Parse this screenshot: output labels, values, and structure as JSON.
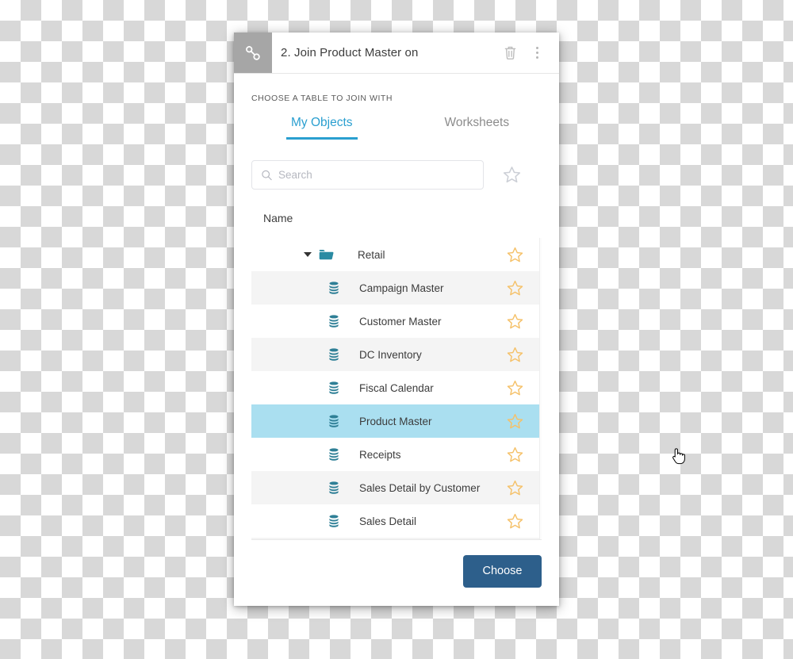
{
  "dialog": {
    "title": "2. Join Product Master on",
    "badge_icon": "link-icon",
    "delete_label": "Delete",
    "more_label": "More options"
  },
  "section": {
    "label": "CHOOSE A TABLE TO JOIN WITH"
  },
  "tabs": [
    {
      "label": "My Objects",
      "active": true
    },
    {
      "label": "Worksheets",
      "active": false
    }
  ],
  "search": {
    "placeholder": "Search",
    "value": "",
    "icon": "search-icon",
    "favorite_filter_icon": "star-outline-icon"
  },
  "list": {
    "column_header": "Name",
    "rows": [
      {
        "label": "Retail",
        "type": "folder",
        "icon": "folder-icon",
        "expanded": true,
        "selected": false,
        "starred": false
      },
      {
        "label": "Campaign Master",
        "type": "table",
        "icon": "database-icon",
        "selected": false,
        "starred": false
      },
      {
        "label": "Customer Master",
        "type": "table",
        "icon": "database-icon",
        "selected": false,
        "starred": false
      },
      {
        "label": "DC Inventory",
        "type": "table",
        "icon": "database-icon",
        "selected": false,
        "starred": false
      },
      {
        "label": "Fiscal Calendar",
        "type": "table",
        "icon": "database-icon",
        "selected": false,
        "starred": false
      },
      {
        "label": "Product Master",
        "type": "table",
        "icon": "database-icon",
        "selected": true,
        "starred": false
      },
      {
        "label": "Receipts",
        "type": "table",
        "icon": "database-icon",
        "selected": false,
        "starred": false
      },
      {
        "label": "Sales Detail by Customer",
        "type": "table",
        "icon": "database-icon",
        "selected": false,
        "starred": false
      },
      {
        "label": "Sales Detail",
        "type": "table",
        "icon": "database-icon",
        "selected": false,
        "starred": false
      }
    ]
  },
  "footer": {
    "choose_label": "Choose"
  },
  "colors": {
    "accent_tab": "#2a9fd0",
    "selected_row": "#aadff0",
    "primary_button": "#2d5f8b",
    "database_icon": "#2e7f96",
    "folder_icon": "#2a8ba3",
    "star": "#f5c169",
    "badge_background": "#a6a6a6"
  }
}
